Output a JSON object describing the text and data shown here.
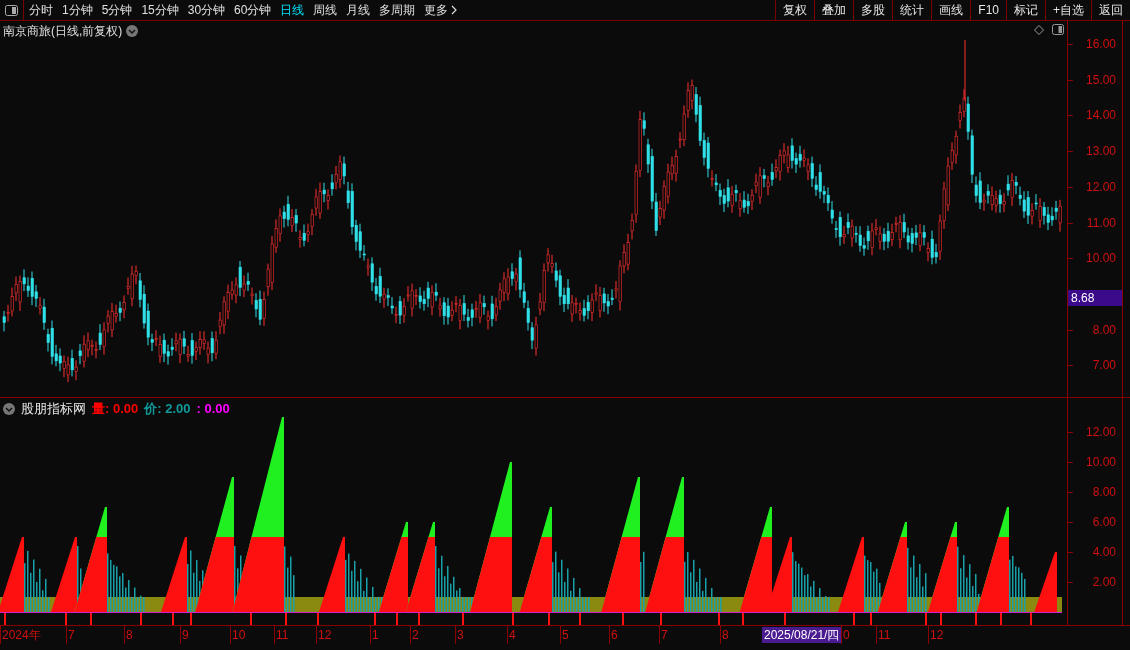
{
  "toolbar": {
    "periods": [
      {
        "label": "分时",
        "selected": false
      },
      {
        "label": "1分钟",
        "selected": false
      },
      {
        "label": "5分钟",
        "selected": false
      },
      {
        "label": "15分钟",
        "selected": false
      },
      {
        "label": "30分钟",
        "selected": false
      },
      {
        "label": "60分钟",
        "selected": false
      },
      {
        "label": "日线",
        "selected": true
      },
      {
        "label": "周线",
        "selected": false
      },
      {
        "label": "月线",
        "selected": false
      },
      {
        "label": "多周期",
        "selected": false
      }
    ],
    "more": "更多",
    "actions": [
      "复权",
      "叠加",
      "多股",
      "统计",
      "画线",
      "F10",
      "标记",
      "+自选",
      "返回"
    ]
  },
  "main_chart": {
    "title": "南京商旅(日线,前复权)",
    "y_ticks": [
      "16.00",
      "15.00",
      "14.00",
      "13.00",
      "12.00",
      "11.00",
      "10.00",
      "8.00",
      "7.00"
    ],
    "current_price": "8.68"
  },
  "indicator": {
    "name": "股朋指标网",
    "legend": [
      {
        "label": "量: 0.00",
        "color": "#ff0000"
      },
      {
        "label": "价: 2.00",
        "color": "#109a9a"
      },
      {
        "label": ": 0.00",
        "color": "#ff00ff"
      }
    ],
    "y_ticks": [
      "12.00",
      "10.00",
      "8.00",
      "6.00",
      "4.00",
      "2.00"
    ]
  },
  "time_axis": {
    "labels": [
      "2024年",
      "7",
      "8",
      "9",
      "10",
      "11",
      "12",
      "1",
      "2",
      "3",
      "4",
      "5",
      "6",
      "7",
      "8",
      "0",
      "11",
      "12"
    ],
    "cursor_date": "2025/08/21/四"
  }
}
